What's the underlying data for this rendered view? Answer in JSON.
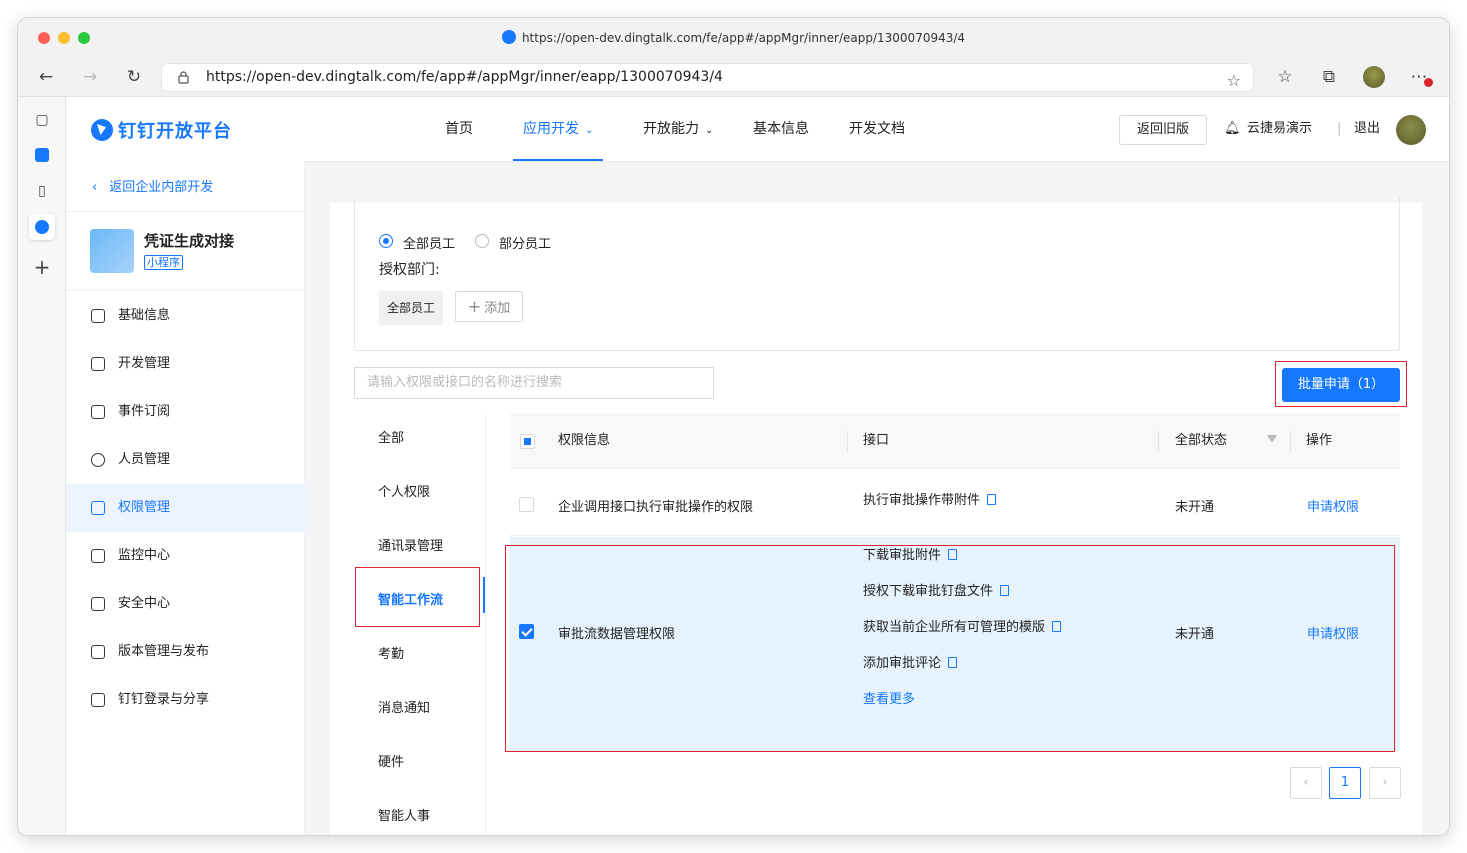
{
  "browser": {
    "title_url": "https://open-dev.dingtalk.com/fe/app#/appMgr/inner/eapp/1300070943/4",
    "address_url": "https://open-dev.dingtalk.com/fe/app#/appMgr/inner/eapp/1300070943/4",
    "traffic_colors": {
      "close": "#fe5f57",
      "minimize": "#febc2e",
      "maximize": "#28c840"
    }
  },
  "nav": {
    "brand": "钉钉开放平台",
    "items": [
      "首页",
      "应用开发",
      "开放能力",
      "基本信息",
      "开发文档"
    ],
    "old_version_button": "返回旧版",
    "org_name": "云捷易演示",
    "logout": "退出"
  },
  "sidebar": {
    "back_link": "返回企业内部开发",
    "app_name": "凭证生成对接",
    "app_tag": "小程序",
    "items": [
      "基础信息",
      "开发管理",
      "事件订阅",
      "人员管理",
      "权限管理",
      "监控中心",
      "安全中心",
      "版本管理与发布",
      "钉钉登录与分享"
    ]
  },
  "scope": {
    "radio_all": "全部员工",
    "radio_part": "部分员工",
    "dept_label": "授权部门:",
    "dept_chip": "全部员工",
    "add_button": "添加"
  },
  "toolbar": {
    "search_placeholder": "请输入权限或接口的名称进行搜索",
    "batch_button": "批量申请（1）"
  },
  "categories": [
    "全部",
    "个人权限",
    "通讯录管理",
    "智能工作流",
    "考勤",
    "消息通知",
    "硬件",
    "智能人事"
  ],
  "table": {
    "headers": {
      "info": "权限信息",
      "api": "接口",
      "status": "全部状态",
      "action": "操作"
    },
    "rows": [
      {
        "info": "企业调用接口执行审批操作的权限",
        "apis": [
          "执行审批操作带附件"
        ],
        "status": "未开通",
        "action": "申请权限"
      },
      {
        "info": "审批流数据管理权限",
        "apis": [
          "下载审批附件",
          "授权下载审批钉盘文件",
          "获取当前企业所有可管理的模版",
          "添加审批评论"
        ],
        "more": "查看更多",
        "status": "未开通",
        "action": "申请权限"
      }
    ]
  },
  "pagination": {
    "current": "1"
  }
}
